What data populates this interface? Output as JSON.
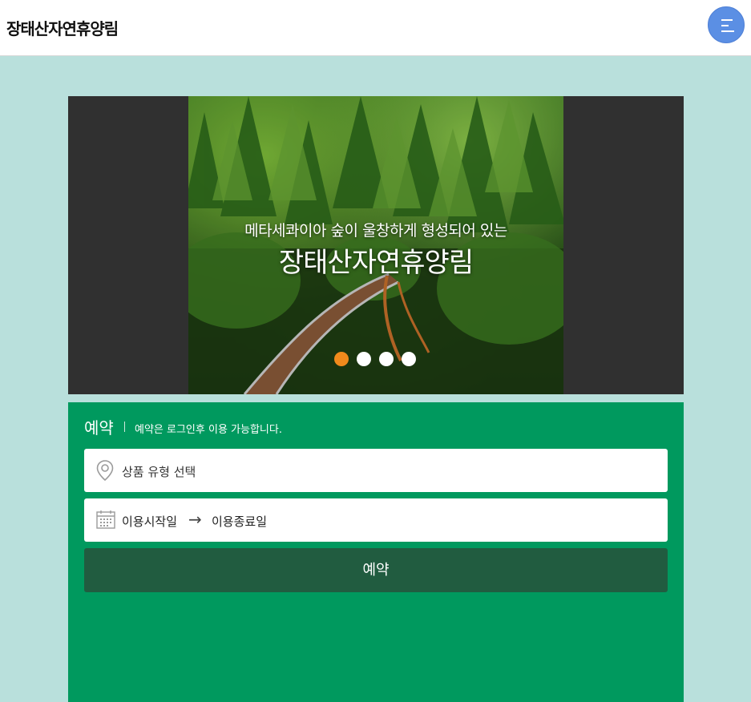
{
  "header": {
    "site_title": "장태산자연휴양림",
    "menu_icon": "menu-icon"
  },
  "slider": {
    "subtitle": "메타세콰이아 숲이 울창하게 형성되어 있는",
    "title": "장태산자연휴양림",
    "image": "forest-skywalk-photo",
    "dot_count": 4,
    "active_dot": 1
  },
  "reservation": {
    "title": "예약",
    "note": "예약은 로그인후 이용 가능합니다.",
    "product_type_placeholder": "상품 유형 선택",
    "product_type_icon": "location-pin-icon",
    "calendar_icon": "calendar-icon",
    "start_date_label": "이용시작일",
    "date_arrow": "→",
    "end_date_label": "이용종료일",
    "submit_label": "예약"
  },
  "colors": {
    "page_bg": "#b9e0dc",
    "menu_button": "#5b8fe4",
    "reservation_bg": "#00995e",
    "reserve_button": "#215c40",
    "active_dot": "#f08a1c"
  }
}
